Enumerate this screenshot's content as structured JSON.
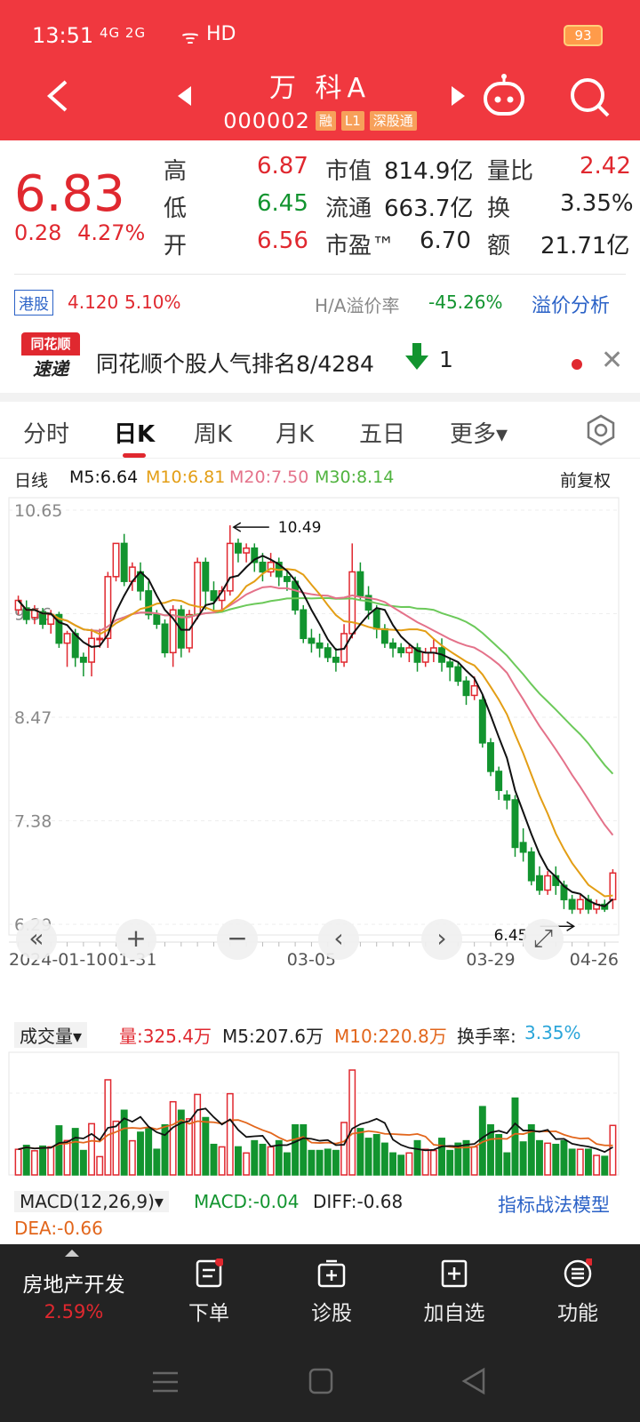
{
  "status": {
    "time": "13:51",
    "signal": "4G 2G",
    "network": "HD",
    "battery": "93"
  },
  "header": {
    "name": "万 科A",
    "code": "000002",
    "tags": [
      "融",
      "L1",
      "深股通"
    ]
  },
  "quote": {
    "price": "6.83",
    "change": "0.28",
    "pct": "4.27%",
    "fields": [
      {
        "label": "高",
        "value": "6.87",
        "color": "red"
      },
      {
        "label": "低",
        "value": "6.45",
        "color": "green"
      },
      {
        "label": "开",
        "value": "6.56",
        "color": "red"
      }
    ],
    "mid": [
      {
        "label": "市值",
        "value": "814.9亿"
      },
      {
        "label": "流通",
        "value": "663.7亿"
      },
      {
        "label": "市盈™",
        "value": "6.70"
      }
    ],
    "right": [
      {
        "label": "量比",
        "value": "2.42",
        "color": "red"
      },
      {
        "label": "换",
        "value": "3.35%"
      },
      {
        "label": "额",
        "value": "21.71亿"
      }
    ]
  },
  "hk": {
    "tag": "港股",
    "price": "4.120",
    "pct": "5.10%",
    "premium_label": "H/A溢价率",
    "premium": "-45.26%",
    "analysis": "溢价分析"
  },
  "news": {
    "logo_top": "同花顺",
    "logo_bottom": "速递",
    "text": "同花顺个股人气排名8/4284",
    "rank_change": "1"
  },
  "tabs": [
    {
      "label": "分时"
    },
    {
      "label": "日K"
    },
    {
      "label": "周K"
    },
    {
      "label": "月K"
    },
    {
      "label": "五日"
    },
    {
      "label": "更多▾"
    }
  ],
  "ma": {
    "label": "日线",
    "m5": "M5:6.64",
    "m10": "M10:6.81",
    "m20": "M20:7.50",
    "m30": "M30:8.14",
    "adj": "前复权"
  },
  "colors": {
    "up": "#e0282f",
    "down": "#12942f",
    "m5": "#111111",
    "m10": "#e39e15",
    "m20": "#e4728a",
    "m30": "#6cc95a"
  },
  "chart_data": {
    "type": "candlestick",
    "y_ticks": [
      "10.65",
      "9.56",
      "8.47",
      "7.38",
      "6.29"
    ],
    "ylim": [
      6.29,
      10.65
    ],
    "x_ticks": [
      "2024-01-10",
      "01-31",
      "03-05",
      "03-29",
      "04-26"
    ],
    "annotations": {
      "high": "10.49",
      "low": "6.45"
    },
    "candles": [
      [
        9.6,
        9.7,
        9.55,
        9.75
      ],
      [
        9.62,
        9.5,
        9.45,
        9.7
      ],
      [
        9.52,
        9.6,
        9.45,
        9.65
      ],
      [
        9.58,
        9.45,
        9.4,
        9.62
      ],
      [
        9.45,
        9.55,
        9.35,
        9.6
      ],
      [
        9.55,
        9.25,
        9.2,
        9.58
      ],
      [
        9.25,
        9.35,
        9.0,
        9.38
      ],
      [
        9.35,
        9.1,
        9.0,
        9.4
      ],
      [
        9.1,
        9.05,
        8.9,
        9.15
      ],
      [
        9.05,
        9.3,
        8.9,
        9.4
      ],
      [
        9.3,
        9.3,
        9.2,
        9.4
      ],
      [
        9.3,
        9.95,
        9.2,
        10.0
      ],
      [
        9.95,
        10.3,
        9.9,
        10.3
      ],
      [
        10.3,
        9.9,
        9.85,
        10.4
      ],
      [
        9.9,
        10.05,
        9.8,
        10.1
      ],
      [
        10.0,
        9.8,
        9.7,
        10.1
      ],
      [
        9.8,
        9.55,
        9.5,
        9.9
      ],
      [
        9.55,
        9.45,
        9.4,
        9.6
      ],
      [
        9.45,
        9.15,
        9.1,
        9.5
      ],
      [
        9.15,
        9.6,
        9.0,
        9.65
      ],
      [
        9.6,
        9.2,
        9.1,
        9.65
      ],
      [
        9.2,
        9.55,
        9.15,
        9.6
      ],
      [
        9.55,
        10.1,
        9.5,
        10.15
      ],
      [
        10.1,
        9.8,
        9.6,
        10.15
      ],
      [
        9.8,
        9.7,
        9.6,
        9.9
      ],
      [
        9.7,
        9.8,
        9.6,
        9.85
      ],
      [
        9.8,
        10.3,
        9.75,
        10.49
      ],
      [
        10.3,
        10.2,
        10.1,
        10.35
      ],
      [
        10.2,
        10.25,
        10.1,
        10.3
      ],
      [
        10.25,
        10.1,
        10.0,
        10.3
      ],
      [
        10.1,
        10.0,
        9.9,
        10.2
      ],
      [
        10.0,
        10.1,
        9.95,
        10.2
      ],
      [
        10.1,
        9.95,
        9.85,
        10.15
      ],
      [
        9.95,
        9.9,
        9.8,
        10.0
      ],
      [
        9.9,
        9.6,
        9.55,
        9.95
      ],
      [
        9.6,
        9.3,
        9.25,
        9.65
      ],
      [
        9.3,
        9.25,
        9.15,
        9.4
      ],
      [
        9.25,
        9.2,
        9.1,
        9.35
      ],
      [
        9.2,
        9.1,
        9.05,
        9.25
      ],
      [
        9.1,
        9.05,
        8.95,
        9.2
      ],
      [
        9.05,
        9.35,
        9.0,
        9.45
      ],
      [
        9.35,
        10.0,
        9.3,
        10.3
      ],
      [
        10.0,
        9.75,
        9.7,
        10.1
      ],
      [
        9.75,
        9.6,
        9.5,
        9.85
      ],
      [
        9.6,
        9.4,
        9.3,
        9.65
      ],
      [
        9.4,
        9.25,
        9.2,
        9.45
      ],
      [
        9.25,
        9.2,
        9.1,
        9.3
      ],
      [
        9.2,
        9.15,
        9.1,
        9.25
      ],
      [
        9.15,
        9.2,
        9.05,
        9.25
      ],
      [
        9.2,
        9.05,
        8.95,
        9.25
      ],
      [
        9.05,
        9.15,
        9.0,
        9.2
      ],
      [
        9.15,
        9.2,
        9.05,
        9.3
      ],
      [
        9.2,
        9.05,
        8.95,
        9.3
      ],
      [
        9.05,
        9.0,
        8.85,
        9.1
      ],
      [
        9.0,
        8.85,
        8.8,
        9.05
      ],
      [
        8.85,
        8.7,
        8.6,
        8.9
      ],
      [
        8.7,
        8.8,
        8.65,
        8.9
      ],
      [
        8.65,
        8.2,
        8.15,
        8.7
      ],
      [
        8.2,
        7.9,
        7.85,
        8.25
      ],
      [
        7.9,
        7.7,
        7.6,
        7.95
      ],
      [
        7.65,
        7.6,
        7.5,
        7.7
      ],
      [
        7.6,
        7.1,
        7.0,
        7.65
      ],
      [
        7.15,
        7.05,
        6.95,
        7.3
      ],
      [
        7.05,
        6.75,
        6.7,
        7.1
      ],
      [
        6.8,
        6.65,
        6.6,
        6.9
      ],
      [
        6.65,
        6.8,
        6.6,
        6.85
      ],
      [
        6.8,
        6.7,
        6.6,
        6.9
      ],
      [
        6.7,
        6.55,
        6.45,
        6.75
      ],
      [
        6.55,
        6.45,
        6.4,
        6.6
      ],
      [
        6.45,
        6.55,
        6.4,
        6.6
      ],
      [
        6.55,
        6.45,
        6.4,
        6.6
      ],
      [
        6.45,
        6.5,
        6.4,
        6.55
      ],
      [
        6.5,
        6.45,
        6.42,
        6.55
      ],
      [
        6.55,
        6.83,
        6.45,
        6.87
      ]
    ]
  },
  "volume": {
    "label": "成交量▾",
    "vol": "量:325.4万",
    "m5": "M5:207.6万",
    "m10": "M10:220.8万",
    "turnover_label": "换手率:",
    "turnover": "3.35%"
  },
  "macd": {
    "label": "MACD(12,26,9)▾",
    "macd": "MACD:-0.04",
    "diff": "DIFF:-0.68",
    "dea": "DEA:-0.66",
    "model": "指标战法模型"
  },
  "bottom": {
    "sector": "房地产开发",
    "sector_pct": "2.59%",
    "items": [
      "下单",
      "诊股",
      "加自选",
      "功能"
    ]
  }
}
